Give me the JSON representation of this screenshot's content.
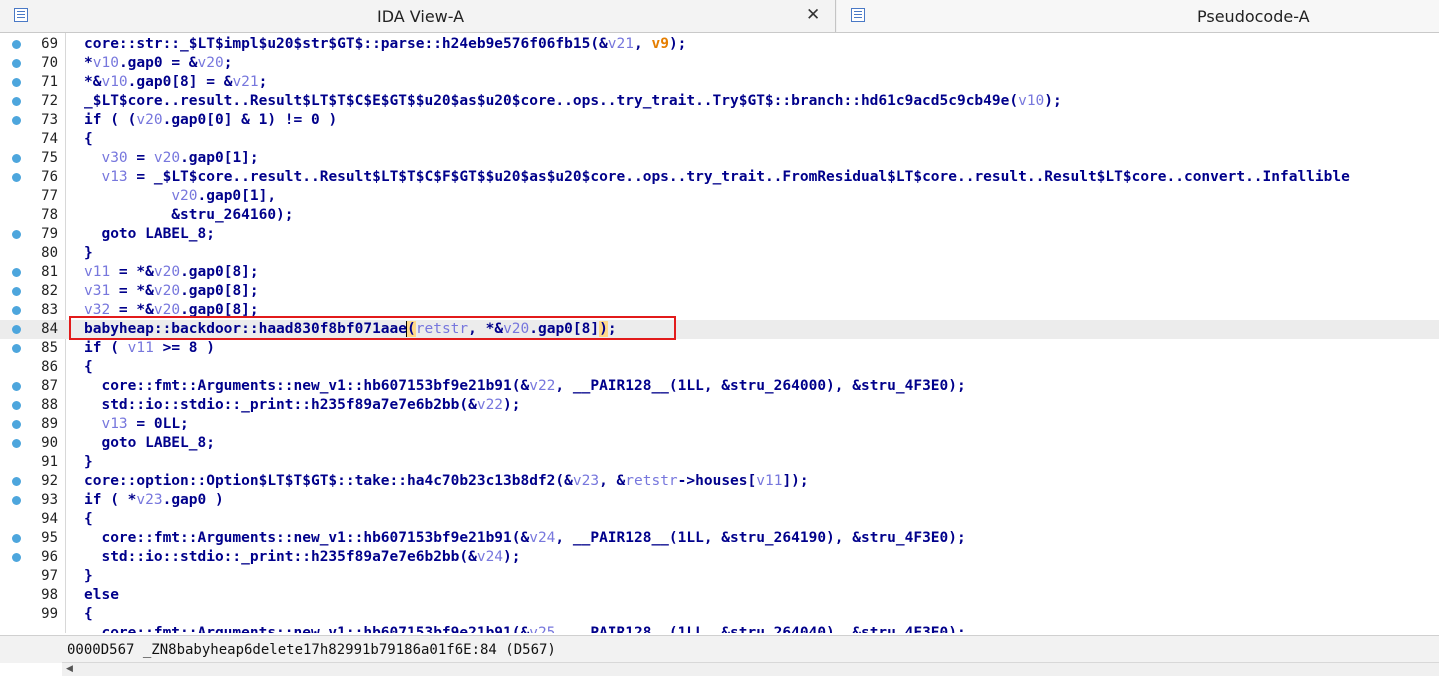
{
  "tabs": {
    "ida": {
      "title": "IDA View-A",
      "close": "✕"
    },
    "pseudo": {
      "title": "Pseudocode-A"
    }
  },
  "editor": {
    "lines": [
      {
        "n": "69",
        "bp": true,
        "parts": [
          {
            "t": "core::str::_$LT$impl$u20$str$GT$::parse::h24eb9e576f06fb15(&"
          },
          {
            "t": "v21",
            "c": "var"
          },
          {
            "t": ", "
          },
          {
            "t": "v9",
            "c": "arg"
          },
          {
            "t": ");"
          }
        ]
      },
      {
        "n": "70",
        "bp": true,
        "parts": [
          {
            "t": "*"
          },
          {
            "t": "v10",
            "c": "var"
          },
          {
            "t": ".gap0 = &"
          },
          {
            "t": "v20",
            "c": "var"
          },
          {
            "t": ";"
          }
        ]
      },
      {
        "n": "71",
        "bp": true,
        "parts": [
          {
            "t": "*&"
          },
          {
            "t": "v10",
            "c": "var"
          },
          {
            "t": ".gap0[8] = &"
          },
          {
            "t": "v21",
            "c": "var"
          },
          {
            "t": ";"
          }
        ]
      },
      {
        "n": "72",
        "bp": true,
        "parts": [
          {
            "t": "_$LT$core..result..Result$LT$T$C$E$GT$$u20$as$u20$core..ops..try_trait..Try$GT$::branch::hd61c9acd5c9cb49e("
          },
          {
            "t": "v10",
            "c": "var"
          },
          {
            "t": ");"
          }
        ]
      },
      {
        "n": "73",
        "bp": true,
        "parts": [
          {
            "t": "if ( ("
          },
          {
            "t": "v20",
            "c": "var"
          },
          {
            "t": ".gap0[0] & 1) != 0 )"
          }
        ]
      },
      {
        "n": "74",
        "bp": false,
        "parts": [
          {
            "t": "{"
          }
        ]
      },
      {
        "n": "75",
        "bp": true,
        "parts": [
          {
            "t": "  "
          },
          {
            "t": "v30",
            "c": "var"
          },
          {
            "t": " = "
          },
          {
            "t": "v20",
            "c": "var"
          },
          {
            "t": ".gap0[1];"
          }
        ]
      },
      {
        "n": "76",
        "bp": true,
        "parts": [
          {
            "t": "  "
          },
          {
            "t": "v13",
            "c": "var"
          },
          {
            "t": " = _$LT$core..result..Result$LT$T$C$F$GT$$u20$as$u20$core..ops..try_trait..FromResidual$LT$core..result..Result$LT$core..convert..Infallible"
          }
        ]
      },
      {
        "n": "77",
        "bp": false,
        "parts": [
          {
            "t": "          "
          },
          {
            "t": "v20",
            "c": "var"
          },
          {
            "t": ".gap0[1],"
          }
        ]
      },
      {
        "n": "78",
        "bp": false,
        "parts": [
          {
            "t": "          &stru_264160);"
          }
        ]
      },
      {
        "n": "79",
        "bp": true,
        "parts": [
          {
            "t": "  goto LABEL_8;"
          }
        ]
      },
      {
        "n": "80",
        "bp": false,
        "parts": [
          {
            "t": "}"
          }
        ]
      },
      {
        "n": "81",
        "bp": true,
        "parts": [
          {
            "t": "v11",
            "c": "var"
          },
          {
            "t": " = *&"
          },
          {
            "t": "v20",
            "c": "var"
          },
          {
            "t": ".gap0[8];"
          }
        ]
      },
      {
        "n": "82",
        "bp": true,
        "parts": [
          {
            "t": "v31",
            "c": "var"
          },
          {
            "t": " = *&"
          },
          {
            "t": "v20",
            "c": "var"
          },
          {
            "t": ".gap0[8];"
          }
        ]
      },
      {
        "n": "83",
        "bp": true,
        "parts": [
          {
            "t": "v32",
            "c": "var"
          },
          {
            "t": " = *&"
          },
          {
            "t": "v20",
            "c": "var"
          },
          {
            "t": ".gap0[8];"
          }
        ]
      },
      {
        "n": "84",
        "bp": true,
        "current": true,
        "parts": [
          {
            "t": "babyheap::backdoor::haad830f8bf071aae"
          },
          {
            "t": "(",
            "c": "hl caret"
          },
          {
            "t": "retstr",
            "c": "var"
          },
          {
            "t": ", *&"
          },
          {
            "t": "v20",
            "c": "var"
          },
          {
            "t": ".gap0[8]"
          },
          {
            "t": ")",
            "c": "hl"
          },
          {
            "t": ";"
          }
        ]
      },
      {
        "n": "85",
        "bp": true,
        "parts": [
          {
            "t": "if ( "
          },
          {
            "t": "v11",
            "c": "var"
          },
          {
            "t": " >= 8 )"
          }
        ]
      },
      {
        "n": "86",
        "bp": false,
        "parts": [
          {
            "t": "{"
          }
        ]
      },
      {
        "n": "87",
        "bp": true,
        "parts": [
          {
            "t": "  core::fmt::Arguments::new_v1::hb607153bf9e21b91(&"
          },
          {
            "t": "v22",
            "c": "var"
          },
          {
            "t": ", __PAIR128__(1LL, &stru_264000), &stru_4F3E0);"
          }
        ]
      },
      {
        "n": "88",
        "bp": true,
        "parts": [
          {
            "t": "  std::io::stdio::_print::h235f89a7e7e6b2bb(&"
          },
          {
            "t": "v22",
            "c": "var"
          },
          {
            "t": ");"
          }
        ]
      },
      {
        "n": "89",
        "bp": true,
        "parts": [
          {
            "t": "  "
          },
          {
            "t": "v13",
            "c": "var"
          },
          {
            "t": " = 0LL;"
          }
        ]
      },
      {
        "n": "90",
        "bp": true,
        "parts": [
          {
            "t": "  goto LABEL_8;"
          }
        ]
      },
      {
        "n": "91",
        "bp": false,
        "parts": [
          {
            "t": "}"
          }
        ]
      },
      {
        "n": "92",
        "bp": true,
        "parts": [
          {
            "t": "core::option::Option$LT$T$GT$::take::ha4c70b23c13b8df2(&"
          },
          {
            "t": "v23",
            "c": "var"
          },
          {
            "t": ", &"
          },
          {
            "t": "retstr",
            "c": "var"
          },
          {
            "t": "->houses["
          },
          {
            "t": "v11",
            "c": "var"
          },
          {
            "t": "]);"
          }
        ]
      },
      {
        "n": "93",
        "bp": true,
        "parts": [
          {
            "t": "if ( *"
          },
          {
            "t": "v23",
            "c": "var"
          },
          {
            "t": ".gap0 )"
          }
        ]
      },
      {
        "n": "94",
        "bp": false,
        "parts": [
          {
            "t": "{"
          }
        ]
      },
      {
        "n": "95",
        "bp": true,
        "parts": [
          {
            "t": "  core::fmt::Arguments::new_v1::hb607153bf9e21b91(&"
          },
          {
            "t": "v24",
            "c": "var"
          },
          {
            "t": ", __PAIR128__(1LL, &stru_264190), &stru_4F3E0);"
          }
        ]
      },
      {
        "n": "96",
        "bp": true,
        "parts": [
          {
            "t": "  std::io::stdio::_print::h235f89a7e7e6b2bb(&"
          },
          {
            "t": "v24",
            "c": "var"
          },
          {
            "t": ");"
          }
        ]
      },
      {
        "n": "97",
        "bp": false,
        "parts": [
          {
            "t": "}"
          }
        ]
      },
      {
        "n": "98",
        "bp": false,
        "parts": [
          {
            "t": "else"
          }
        ]
      },
      {
        "n": "99",
        "bp": false,
        "parts": [
          {
            "t": "{"
          }
        ]
      },
      {
        "n": "",
        "bp": false,
        "parts": [
          {
            "t": "  core::fmt::Arguments::new_v1::hb607153bf9e21b91(&"
          },
          {
            "t": "v25",
            "c": "var"
          },
          {
            "t": ", __PAIR128__(1LL, &stru_264040), &stru_4F3E0);"
          }
        ]
      }
    ]
  },
  "status": {
    "text": "0000D567 _ZN8babyheap6delete17h82991b79186a01f6E:84 (D567)"
  },
  "colors": {
    "keyword": "#00008b",
    "variable": "#7777dd",
    "argument": "#e57e00",
    "highlight": "#ffd98a",
    "selection_box": "#e21b1b",
    "breakpoint": "#4da6dd"
  }
}
